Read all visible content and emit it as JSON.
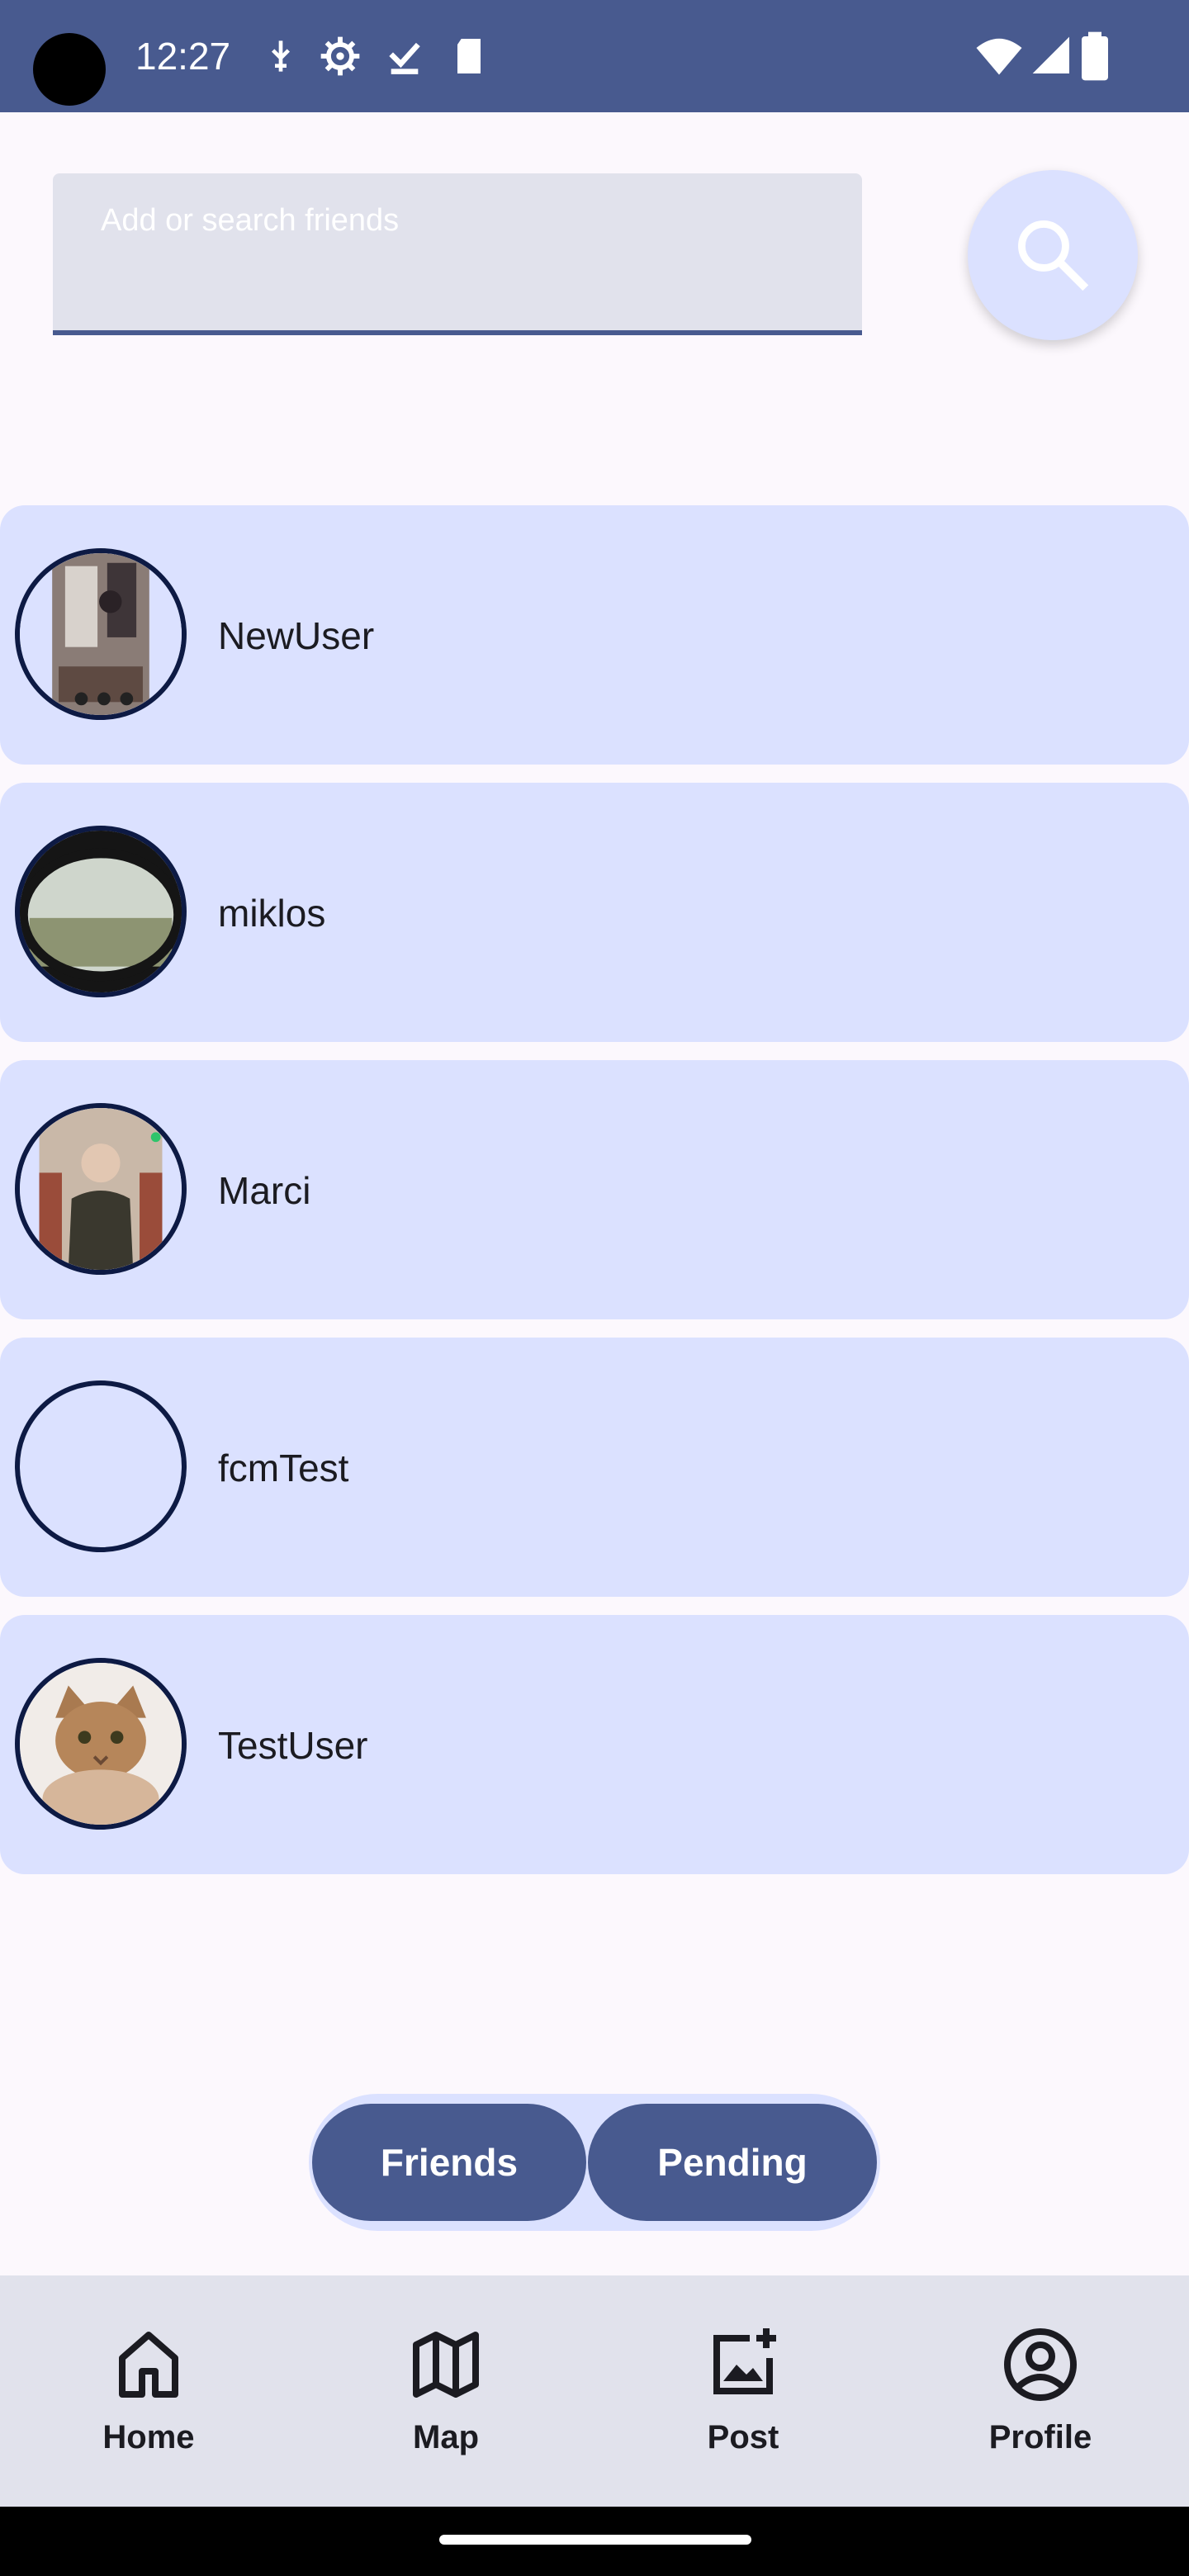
{
  "status_bar": {
    "time": "12:27",
    "icons": [
      "usb-debug-icon",
      "settings-gear-icon",
      "download-done-icon",
      "sd-card-icon",
      "wifi-icon",
      "signal-icon",
      "battery-icon"
    ],
    "background": "#485a8f"
  },
  "search": {
    "placeholder": "Add or search friends",
    "button_icon": "search-icon"
  },
  "friends": [
    {
      "name": "NewUser",
      "avatar": "photo-gym-mirror"
    },
    {
      "name": "miklos",
      "avatar": "photo-landscape"
    },
    {
      "name": "Marci",
      "avatar": "photo-person"
    },
    {
      "name": "fcmTest",
      "avatar": "empty"
    },
    {
      "name": "TestUser",
      "avatar": "photo-cat"
    }
  ],
  "segmented": {
    "friends_label": "Friends",
    "pending_label": "Pending"
  },
  "bottom_nav": [
    {
      "label": "Home",
      "icon": "home-icon"
    },
    {
      "label": "Map",
      "icon": "map-icon"
    },
    {
      "label": "Post",
      "icon": "add-photo-icon"
    },
    {
      "label": "Profile",
      "icon": "account-circle-icon"
    }
  ],
  "colors": {
    "primary": "#485a8f",
    "card": "#dbe1ff",
    "surface": "#fcf8fd",
    "nav": "#e1e2ec"
  }
}
